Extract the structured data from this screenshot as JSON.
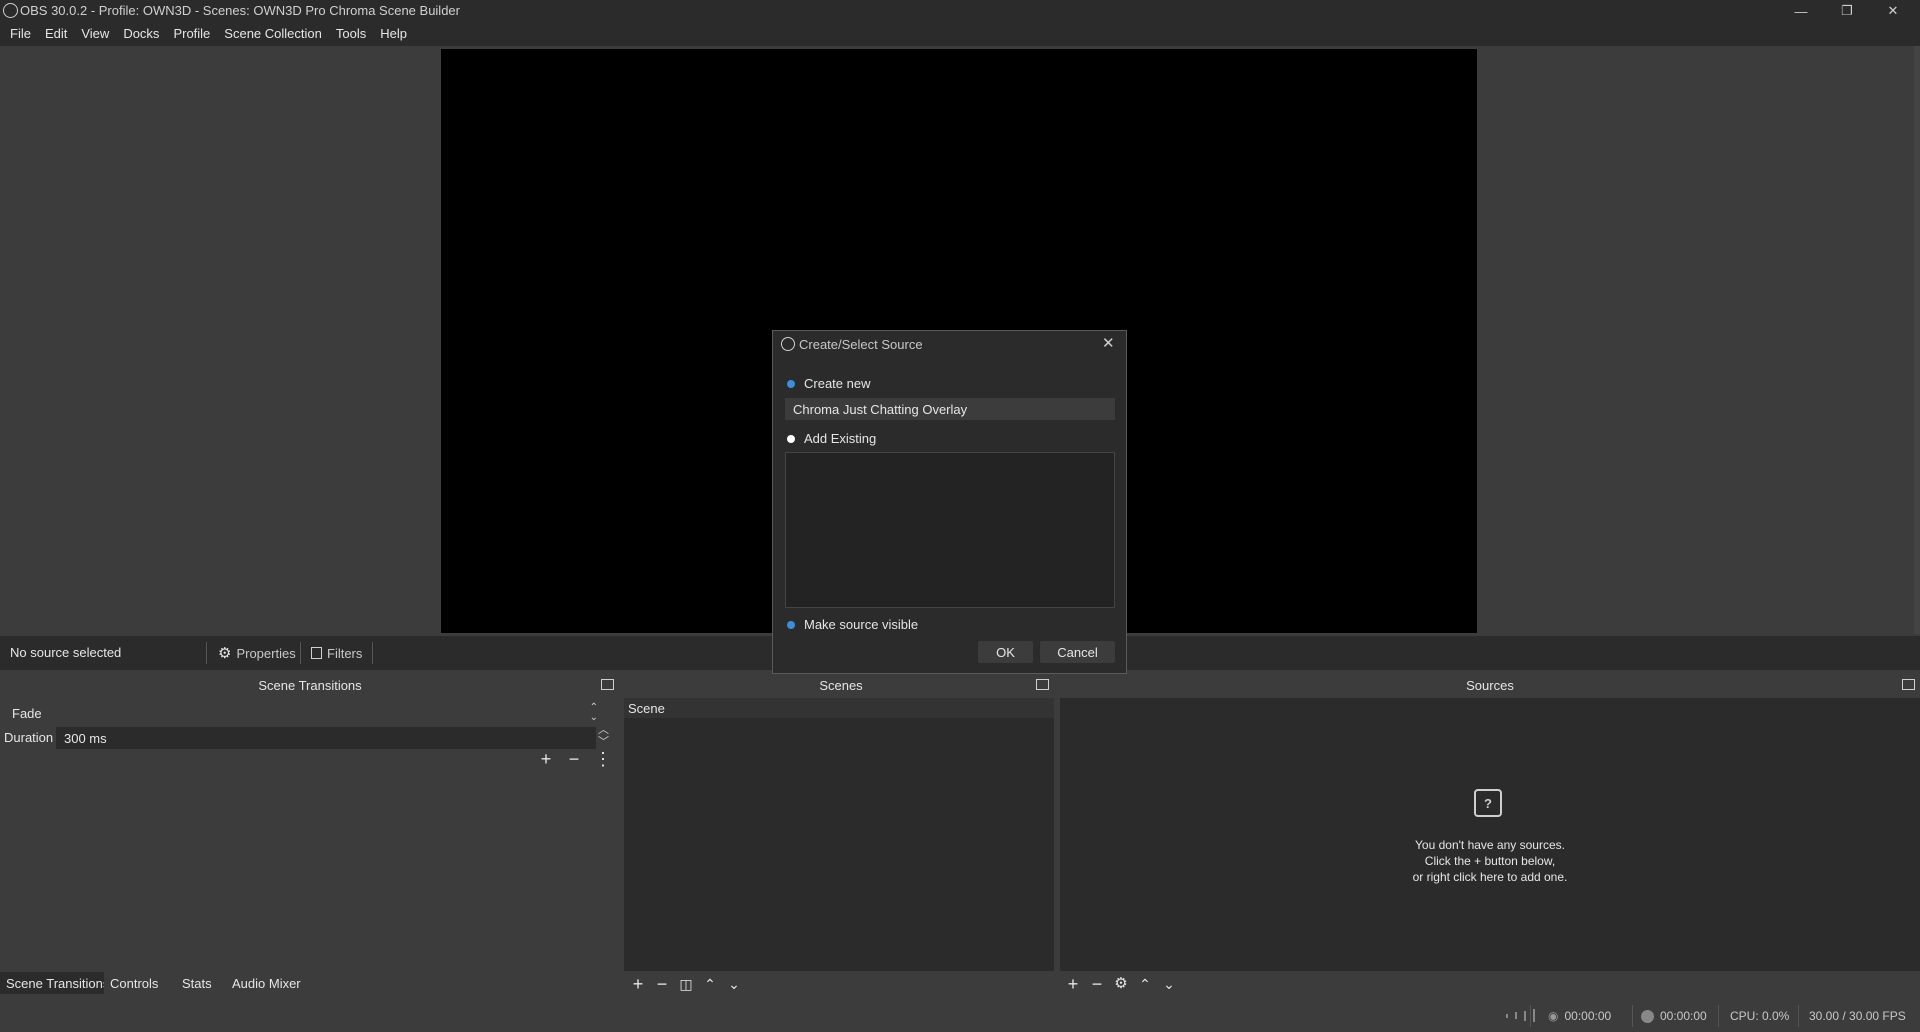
{
  "window": {
    "title": "OBS 30.0.2 - Profile: OWN3D - Scenes: OWN3D Pro Chroma Scene Builder",
    "minimize": "—",
    "restore": "❐",
    "close": "✕"
  },
  "menu": [
    "File",
    "Edit",
    "View",
    "Docks",
    "Profile",
    "Scene Collection",
    "Tools",
    "Help"
  ],
  "context_bar": {
    "status": "No source selected",
    "properties": "Properties",
    "filters": "Filters"
  },
  "dialog": {
    "title": "Create/Select Source",
    "create_new": "Create new",
    "name_value": "Chroma Just Chatting Overlay",
    "add_existing": "Add Existing",
    "make_visible": "Make source visible",
    "ok": "OK",
    "cancel": "Cancel",
    "accent": "#3b8fd6"
  },
  "transitions": {
    "header": "Scene Transitions",
    "selected": "Fade",
    "duration_label": "Duration",
    "duration_value": "300 ms"
  },
  "scenes": {
    "header": "Scenes",
    "items": [
      "Scene"
    ]
  },
  "sources": {
    "header": "Sources",
    "empty_line1": "You don't have any sources.",
    "empty_line2": "Click the + button below,",
    "empty_line3": "or right click here to add one."
  },
  "tabs": [
    "Scene Transitions",
    "Controls",
    "Stats",
    "Audio Mixer"
  ],
  "status": {
    "stream_time": "00:00:00",
    "record_time": "00:00:00",
    "cpu": "CPU: 0.0%",
    "fps": "30.00 / 30.00 FPS"
  }
}
